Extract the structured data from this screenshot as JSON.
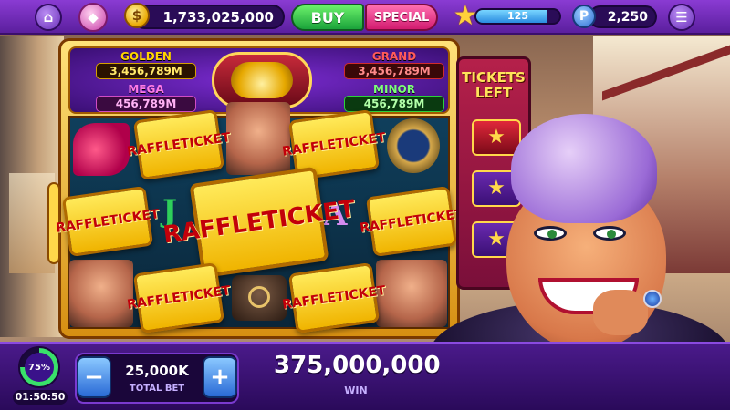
{
  "top_bar": {
    "coins": "1,733,025,000",
    "buy_label": "BUY",
    "special_label": "SPECIAL",
    "xp_value": "125",
    "xp_progress": 0.85,
    "points": "2,250",
    "icons": {
      "home": "home-icon",
      "gem": "gem-icon",
      "coin": "coin-icon",
      "star": "star-icon",
      "points": "p-icon",
      "menu": "menu-icon"
    },
    "coin_glyph": "$",
    "points_glyph": "P"
  },
  "jackpots": {
    "golden": {
      "label": "GOLDEN",
      "value": "3,456,789M"
    },
    "mega": {
      "label": "MEGA",
      "value": "456,789M"
    },
    "grand": {
      "label": "GRAND",
      "value": "3,456,789M"
    },
    "minor": {
      "label": "MINOR",
      "value": "456,789M"
    }
  },
  "reels": {
    "ticket_text": "RAFFLE TICKET",
    "letters": [
      "J",
      "A"
    ],
    "letter_colors": {
      "J": "#2ecf5a",
      "A": "#d48bf0"
    }
  },
  "tickets_left": {
    "title": "TICKETS LEFT"
  },
  "bottom_bar": {
    "level_progress": "75%",
    "timer": "01:50:50",
    "total_bet_value": "25,000K",
    "total_bet_label": "TOTAL BET",
    "minus_label": "−",
    "plus_label": "+",
    "win_value": "375,000,000",
    "win_label": "WIN"
  },
  "colors": {
    "topbar": "#6a2bb8",
    "buy": "#1aa23a",
    "special": "#d21b6f",
    "ticket_fill": "#f5c800",
    "ticket_text": "#c2000a",
    "bottombar": "#3a127a"
  }
}
